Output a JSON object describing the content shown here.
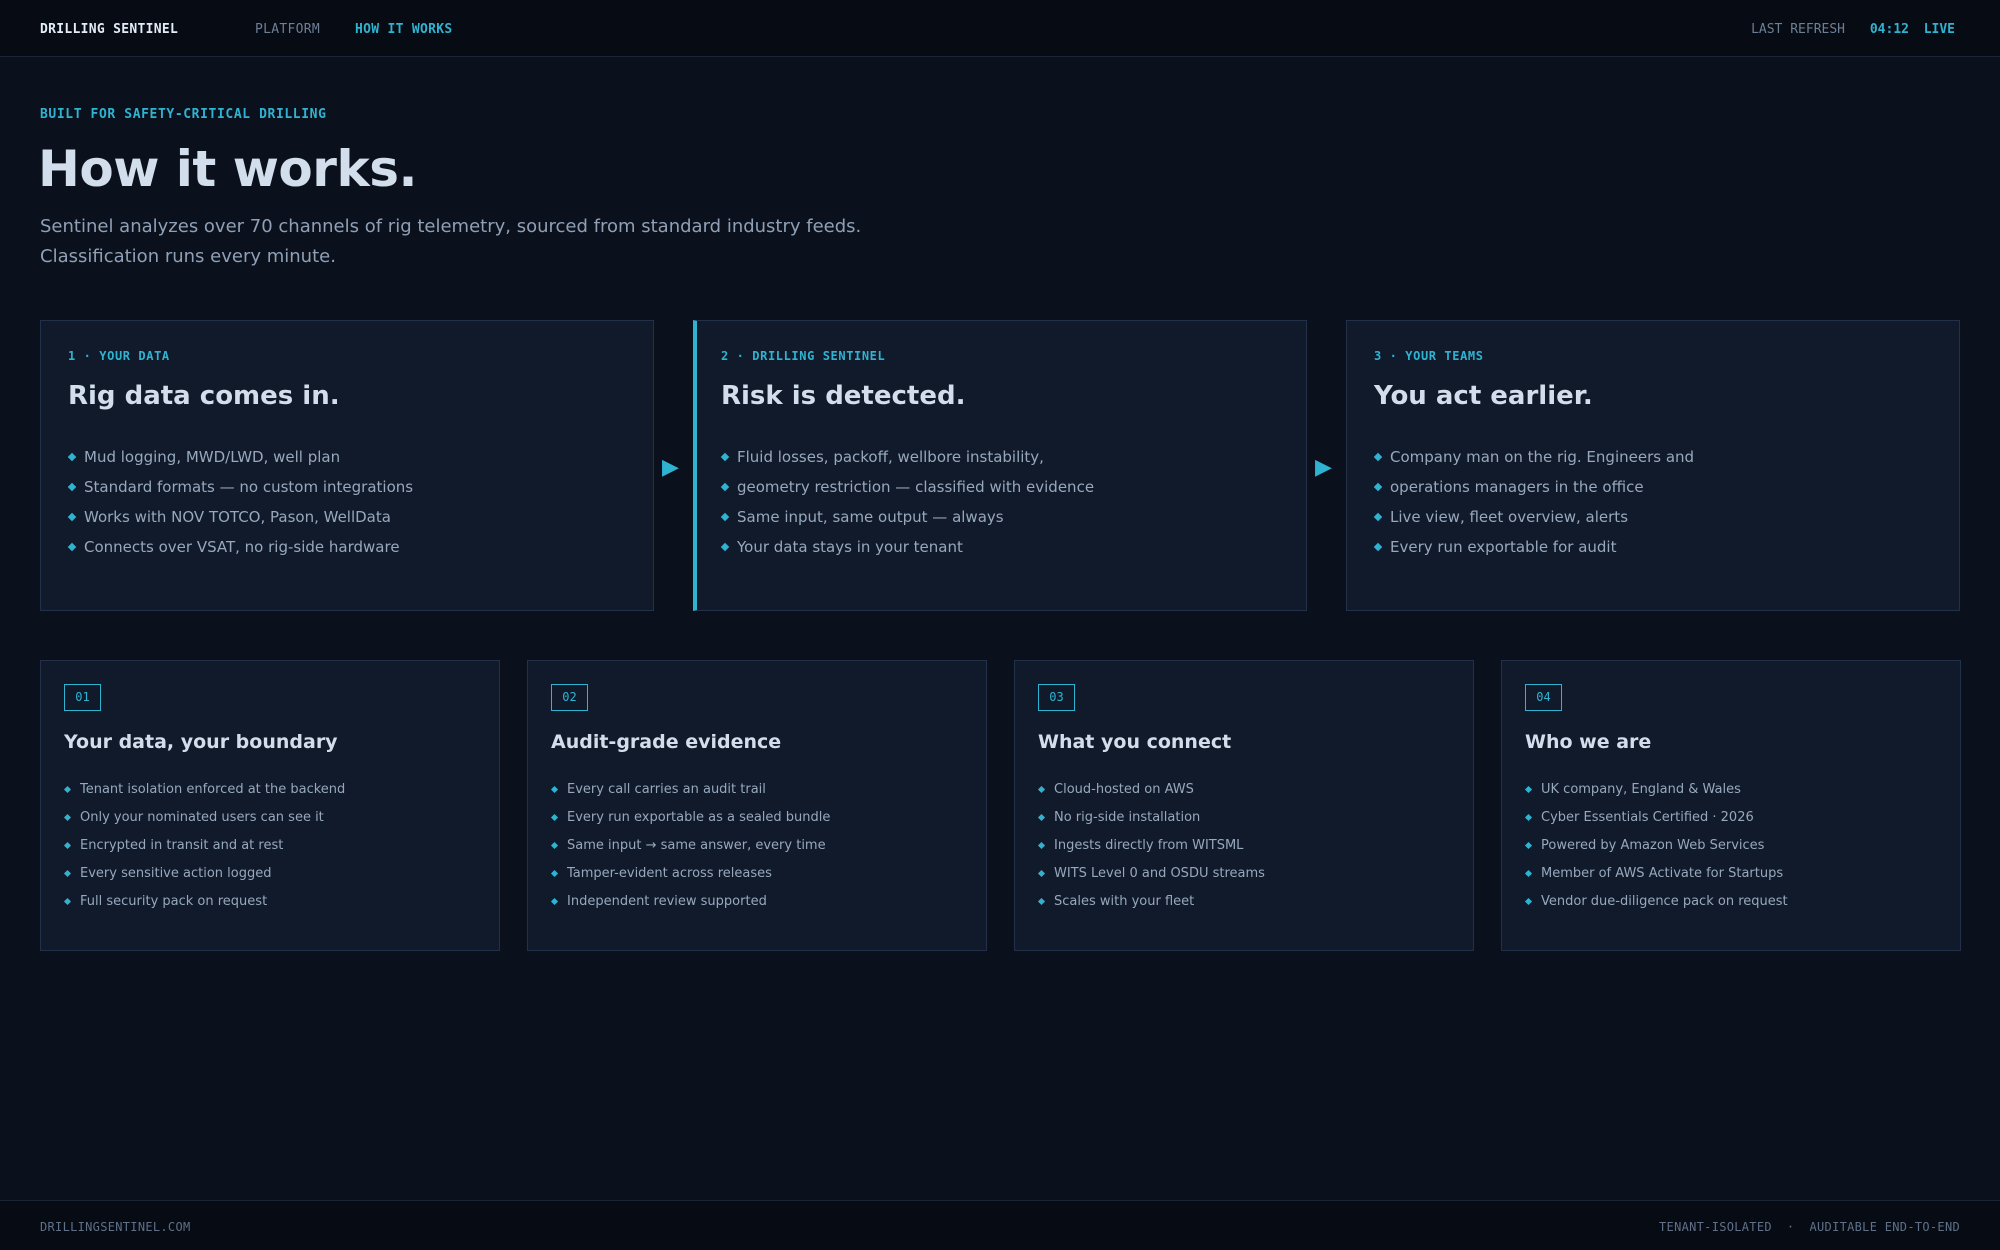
{
  "topbar": {
    "brand": "DRILLING SENTINEL",
    "nav": [
      {
        "label": "PLATFORM"
      },
      {
        "label": "HOW IT WORKS"
      }
    ],
    "refresh_label": "LAST REFRESH",
    "refresh_time": "04:12",
    "status": "LIVE"
  },
  "hero": {
    "eyebrow": "BUILT FOR SAFETY-CRITICAL DRILLING",
    "title": "How it works.",
    "subtitle_line1": "Sentinel analyzes over 70 channels of rig telemetry, sourced from standard industry feeds.",
    "subtitle_line2": "Classification runs every minute."
  },
  "steps": [
    {
      "eyebrow": "1 · YOUR DATA",
      "title": "Rig data comes in.",
      "items": [
        "Mud logging, MWD/LWD, well plan",
        "Standard formats — no custom integrations",
        "Works with NOV TOTCO, Pason, WellData",
        "Connects over VSAT, no rig-side hardware"
      ]
    },
    {
      "eyebrow": "2 · DRILLING SENTINEL",
      "title": "Risk is detected.",
      "items": [
        "Fluid losses, packoff, wellbore instability,",
        "geometry restriction — classified with evidence",
        "Same input, same output — always",
        "Your data stays in your tenant"
      ]
    },
    {
      "eyebrow": "3 · YOUR TEAMS",
      "title": "You act earlier.",
      "items": [
        "Company man on the rig. Engineers and",
        "operations managers in the office",
        "Live view, fleet overview, alerts",
        "Every run exportable for audit"
      ]
    }
  ],
  "arrow_glyph": "▶",
  "features": [
    {
      "num": "01",
      "title": "Your data, your boundary",
      "items": [
        "Tenant isolation enforced at the backend",
        "Only your nominated users can see it",
        "Encrypted in transit and at rest",
        "Every sensitive action logged",
        "Full security pack on request"
      ]
    },
    {
      "num": "02",
      "title": "Audit-grade evidence",
      "items": [
        "Every call carries an audit trail",
        "Every run exportable as a sealed bundle",
        "Same input → same answer, every time",
        "Tamper-evident across releases",
        "Independent review supported"
      ]
    },
    {
      "num": "03",
      "title": "What you connect",
      "items": [
        "Cloud-hosted on AWS",
        "No rig-side installation",
        "Ingests directly from WITSML",
        "WITS Level 0 and OSDU streams",
        "Scales with your fleet"
      ]
    },
    {
      "num": "04",
      "title": "Who we are",
      "items": [
        "UK company, England & Wales",
        "Cyber Essentials Certified · 2026",
        "Powered by Amazon Web Services",
        "Member of AWS Activate for Startups",
        "Vendor due-diligence pack on request"
      ]
    }
  ],
  "footer": {
    "left": "DRILLINGSENTINEL.COM",
    "right": "TENANT-ISOLATED  ·  AUDITABLE END-TO-END"
  },
  "colors": {
    "background": "#0b111c",
    "accent": "#2fb3d1",
    "card": "#111a2b"
  }
}
